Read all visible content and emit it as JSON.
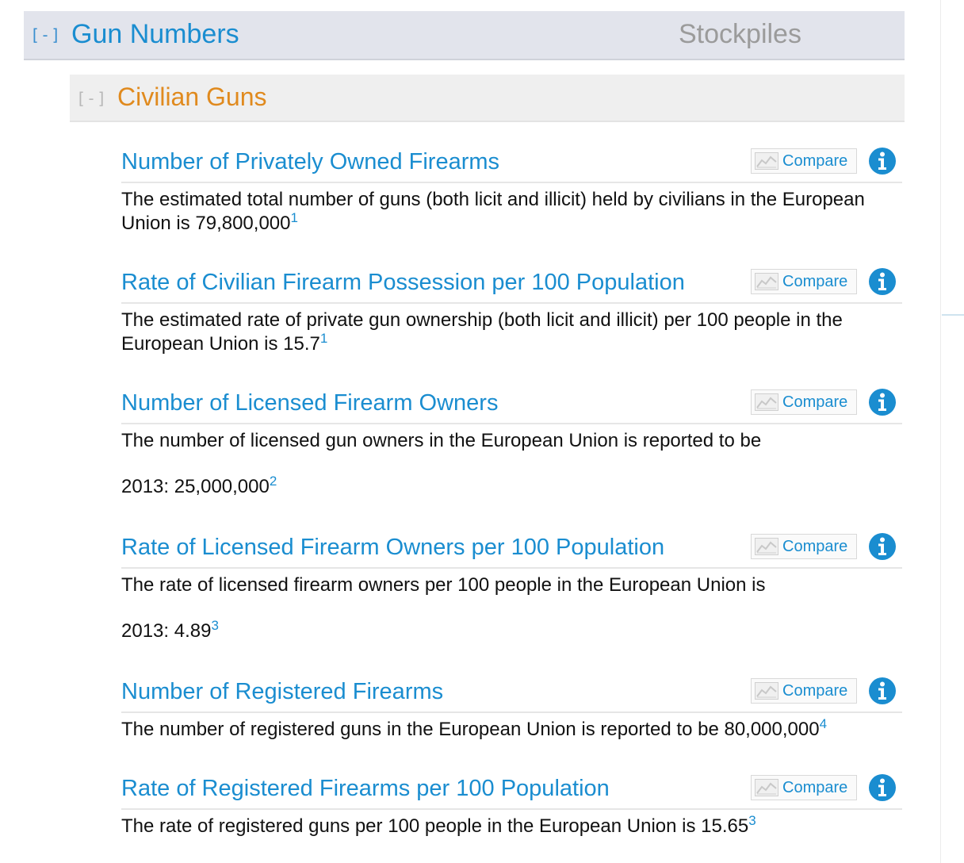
{
  "section": {
    "toggle": "[-]",
    "title": "Gun Numbers",
    "tab": "Stockpiles"
  },
  "subsection": {
    "toggle": "[-]",
    "title": "Civilian Guns"
  },
  "compare_label": "Compare",
  "colors": {
    "link_blue": "#1a8dd0",
    "subsection_orange": "#e08a1e",
    "header_bg": "#e2e4ec"
  },
  "items": [
    {
      "title": "Number of Privately Owned Firearms",
      "description": "The estimated total number of guns (both licit and illicit) held by civilians in the European Union is 79,800,000",
      "footnote": "1"
    },
    {
      "title": "Rate of Civilian Firearm Possession per 100 Population",
      "description": "The estimated rate of private gun ownership (both licit and illicit) per 100 people in the European Union is 15.7",
      "footnote": "1"
    },
    {
      "title": "Number of Licensed Firearm Owners",
      "description": "The number of licensed gun owners in the European Union is reported to be",
      "value": "2013: 25,000,000",
      "footnote": "2"
    },
    {
      "title": "Rate of Licensed Firearm Owners per 100 Population",
      "description": "The rate of licensed firearm owners per 100 people in the European Union is",
      "value": "2013: 4.89",
      "footnote": "3"
    },
    {
      "title": "Number of Registered Firearms",
      "description": "The number of registered guns in the European Union is reported to be 80,000,000",
      "footnote": "4"
    },
    {
      "title": "Rate of Registered Firearms per 100 Population",
      "description": "The rate of registered guns per 100 people in the European Union is 15.65",
      "footnote": "3"
    }
  ]
}
